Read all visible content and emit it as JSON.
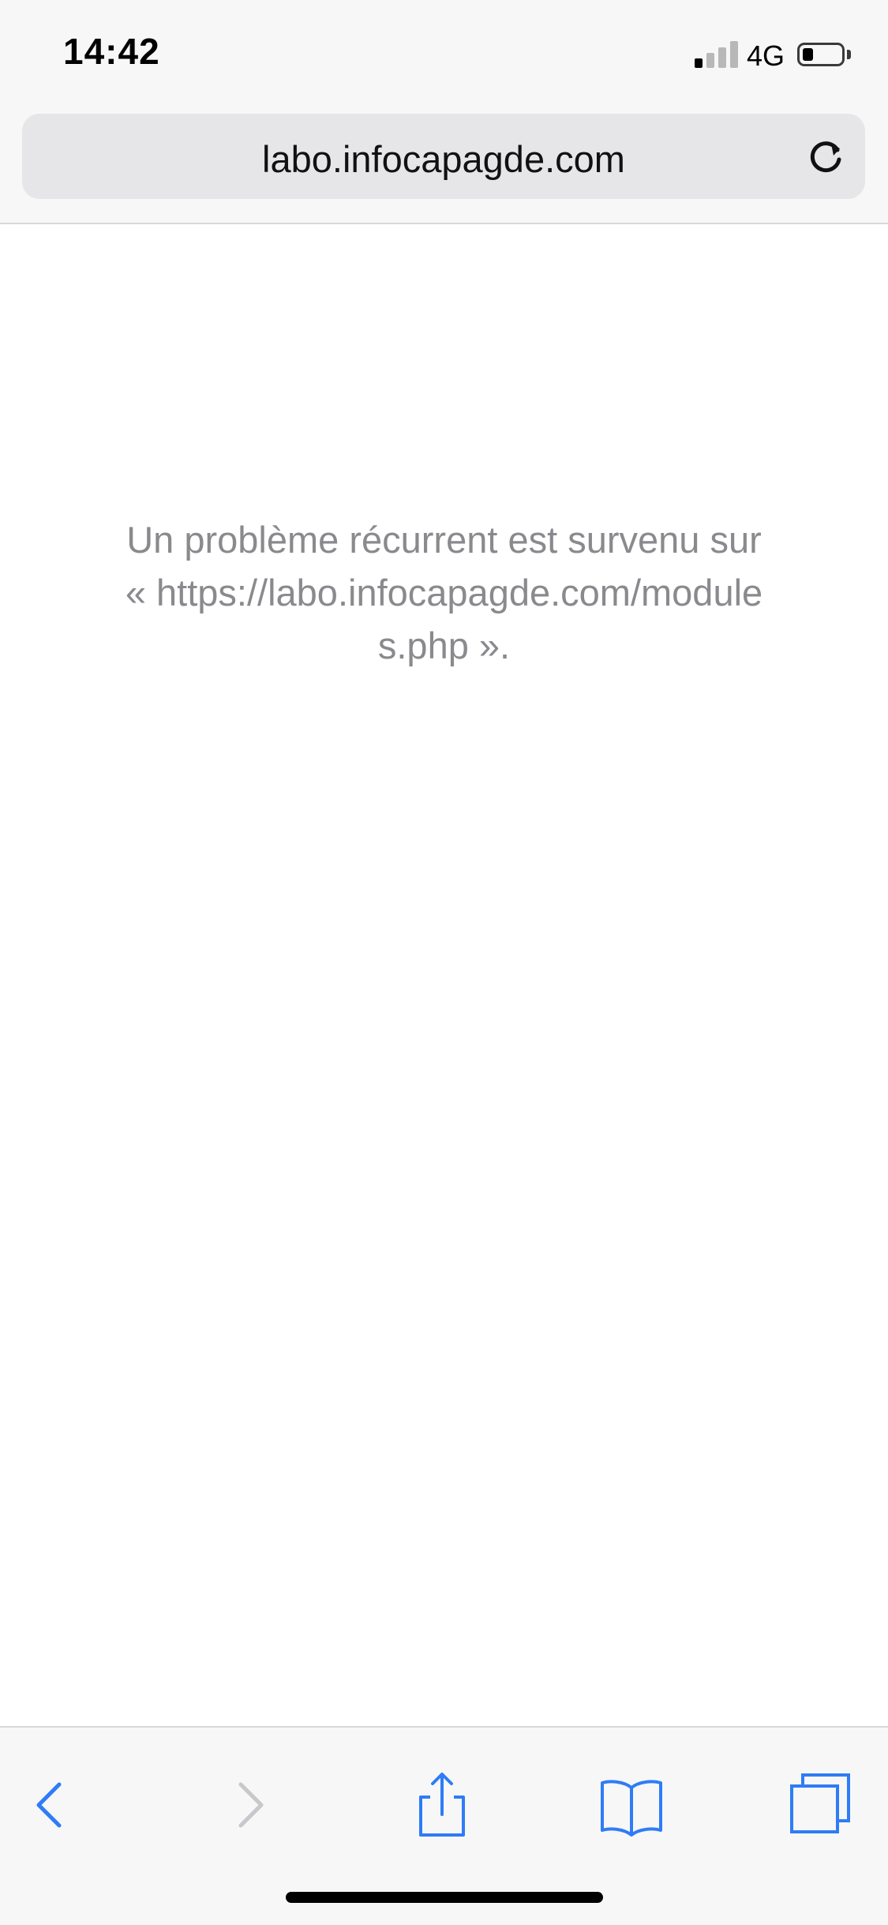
{
  "status_bar": {
    "time": "14:42",
    "network": "4G",
    "signal_bars_active": 1,
    "signal_bars_total": 4,
    "battery_level": 0.25
  },
  "address_bar": {
    "url_display": "labo.infocapagde.com",
    "reload_icon": "reload-icon"
  },
  "page": {
    "error_message": "Un problème récurrent est survenu sur « https://labo.infocapagde.com/modules.php »."
  },
  "toolbar": {
    "back_icon": "chevron-left-icon",
    "forward_icon": "chevron-right-icon",
    "share_icon": "share-icon",
    "bookmarks_icon": "book-icon",
    "tabs_icon": "tabs-icon"
  },
  "colors": {
    "accent": "#2f7cf6",
    "disabled": "#c7c7cc",
    "message_text": "#8a8a8e",
    "bar_background": "#f7f7f7"
  }
}
